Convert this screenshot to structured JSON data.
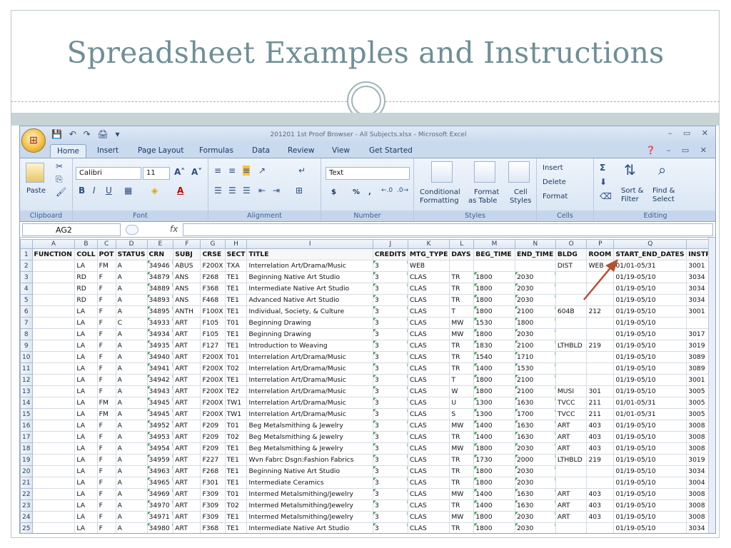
{
  "slide": {
    "title": "Spreadsheet Examples and Instructions"
  },
  "window": {
    "title": "201201 1st Proof Browser - All Subjects.xlsx - Microsoft Excel"
  },
  "tabs": [
    "Home",
    "Insert",
    "Page Layout",
    "Formulas",
    "Data",
    "Review",
    "View",
    "Get Started"
  ],
  "ribbon": {
    "clipboard": {
      "label": "Clipboard",
      "paste": "Paste"
    },
    "font": {
      "label": "Font",
      "name": "Calibri",
      "size": "11"
    },
    "alignment": {
      "label": "Alignment"
    },
    "number": {
      "label": "Number",
      "format": "Text",
      "currency": "$",
      "percent": "%",
      "comma": ","
    },
    "styles": {
      "label": "Styles",
      "conditional": "Conditional",
      "conditional2": "Formatting",
      "format_table": "Format",
      "format_table2": "as Table",
      "cell_styles": "Cell",
      "cell_styles2": "Styles"
    },
    "cells": {
      "label": "Cells",
      "insert": "Insert",
      "delete": "Delete",
      "format": "Format"
    },
    "editing": {
      "label": "Editing",
      "sort": "Sort &",
      "sort2": "Filter",
      "find": "Find &",
      "find2": "Select"
    }
  },
  "namebox": "AG2",
  "formula_symbol": "fx",
  "columns": [
    "A",
    "B",
    "C",
    "D",
    "E",
    "F",
    "G",
    "H",
    "I",
    "J",
    "K",
    "L",
    "M",
    "N",
    "O",
    "P",
    "Q",
    ""
  ],
  "headers": [
    "FUNCTION",
    "COLL",
    "POT",
    "STATUS",
    "CRN",
    "SUBJ",
    "CRSE",
    "SECT",
    "TITLE",
    "CREDITS",
    "MTG_TYPE",
    "DAYS",
    "BEG_TIME",
    "END_TIME",
    "BLDG",
    "ROOM",
    "START_END_DATES",
    "INSTR"
  ],
  "rows": [
    [
      "2",
      "",
      "LA",
      "FM",
      "A",
      "34946",
      "ABUS",
      "F200X",
      "TXA",
      "Interrelation Art/Drama/Music",
      "3",
      "WEB",
      "",
      "",
      "",
      "DIST",
      "WEB",
      "01/01-05/31",
      "3001"
    ],
    [
      "3",
      "",
      "RD",
      "F",
      "A",
      "34879",
      "ANS",
      "F268",
      "TE1",
      "Beginning Native Art Studio",
      "3",
      "CLAS",
      "TR",
      "1800",
      "2030",
      "",
      "",
      "01/19-05/10",
      "3034"
    ],
    [
      "4",
      "",
      "RD",
      "F",
      "A",
      "34889",
      "ANS",
      "F368",
      "TE1",
      "Intermediate Native Art Studio",
      "3",
      "CLAS",
      "TR",
      "1800",
      "2030",
      "",
      "",
      "01/19-05/10",
      "3034"
    ],
    [
      "5",
      "",
      "RD",
      "F",
      "A",
      "34893",
      "ANS",
      "F468",
      "TE1",
      "Advanced Native Art Studio",
      "3",
      "CLAS",
      "TR",
      "1800",
      "2030",
      "",
      "",
      "01/19-05/10",
      "3034"
    ],
    [
      "6",
      "",
      "LA",
      "F",
      "A",
      "34895",
      "ANTH",
      "F100X",
      "TE1",
      "Individual, Society, & Culture",
      "3",
      "CLAS",
      "T",
      "1800",
      "2100",
      "604B",
      "212",
      "01/19-05/10",
      "3001"
    ],
    [
      "7",
      "",
      "LA",
      "F",
      "C",
      "34933",
      "ART",
      "F105",
      "T01",
      "Beginning Drawing",
      "3",
      "CLAS",
      "MW",
      "1530",
      "1800",
      "",
      "",
      "01/19-05/10",
      ""
    ],
    [
      "8",
      "",
      "LA",
      "F",
      "A",
      "34934",
      "ART",
      "F105",
      "TE1",
      "Beginning Drawing",
      "3",
      "CLAS",
      "MW",
      "1800",
      "2030",
      "",
      "",
      "01/19-05/10",
      "3017"
    ],
    [
      "9",
      "",
      "LA",
      "F",
      "A",
      "34935",
      "ART",
      "F127",
      "TE1",
      "Introduction to Weaving",
      "3",
      "CLAS",
      "TR",
      "1830",
      "2100",
      "LTHBLD",
      "219",
      "01/19-05/10",
      "3019"
    ],
    [
      "10",
      "",
      "LA",
      "F",
      "A",
      "34940",
      "ART",
      "F200X",
      "T01",
      "Interrelation Art/Drama/Music",
      "3",
      "CLAS",
      "TR",
      "1540",
      "1710",
      "",
      "",
      "01/19-05/10",
      "3089"
    ],
    [
      "11",
      "",
      "LA",
      "F",
      "A",
      "34941",
      "ART",
      "F200X",
      "T02",
      "Interrelation Art/Drama/Music",
      "3",
      "CLAS",
      "TR",
      "1400",
      "1530",
      "",
      "",
      "01/19-05/10",
      "3089"
    ],
    [
      "12",
      "",
      "LA",
      "F",
      "A",
      "34942",
      "ART",
      "F200X",
      "TE1",
      "Interrelation Art/Drama/Music",
      "3",
      "CLAS",
      "T",
      "1800",
      "2100",
      "",
      "",
      "01/19-05/10",
      "3001"
    ],
    [
      "13",
      "",
      "LA",
      "F",
      "A",
      "34943",
      "ART",
      "F200X",
      "TE2",
      "Interrelation Art/Drama/Music",
      "3",
      "CLAS",
      "W",
      "1800",
      "2100",
      "MUSI",
      "301",
      "01/19-05/10",
      "3005"
    ],
    [
      "14",
      "",
      "LA",
      "FM",
      "A",
      "34945",
      "ART",
      "F200X",
      "TW1",
      "Interrelation Art/Drama/Music",
      "3",
      "CLAS",
      "U",
      "1300",
      "1630",
      "TVCC",
      "211",
      "01/01-05/31",
      "3005"
    ],
    [
      "15",
      "",
      "LA",
      "FM",
      "A",
      "34945",
      "ART",
      "F200X",
      "TW1",
      "Interrelation Art/Drama/Music",
      "3",
      "CLAS",
      "S",
      "1300",
      "1700",
      "TVCC",
      "211",
      "01/01-05/31",
      "3005"
    ],
    [
      "16",
      "",
      "LA",
      "F",
      "A",
      "34952",
      "ART",
      "F209",
      "T01",
      "Beg Metalsmithing & Jewelry",
      "3",
      "CLAS",
      "MW",
      "1400",
      "1630",
      "ART",
      "403",
      "01/19-05/10",
      "3008"
    ],
    [
      "17",
      "",
      "LA",
      "F",
      "A",
      "34953",
      "ART",
      "F209",
      "T02",
      "Beg Metalsmithing & Jewelry",
      "3",
      "CLAS",
      "TR",
      "1400",
      "1630",
      "ART",
      "403",
      "01/19-05/10",
      "3008"
    ],
    [
      "18",
      "",
      "LA",
      "F",
      "A",
      "34954",
      "ART",
      "F209",
      "TE1",
      "Beg Metalsmithing & Jewelry",
      "3",
      "CLAS",
      "MW",
      "1800",
      "2030",
      "ART",
      "403",
      "01/19-05/10",
      "3008"
    ],
    [
      "19",
      "",
      "LA",
      "F",
      "A",
      "34959",
      "ART",
      "F227",
      "TE1",
      "Wvn Fabrc Dsgn:Fashion Fabrics",
      "3",
      "CLAS",
      "TR",
      "1730",
      "2000",
      "LTHBLD",
      "219",
      "01/19-05/10",
      "3019"
    ],
    [
      "20",
      "",
      "LA",
      "F",
      "A",
      "34963",
      "ART",
      "F268",
      "TE1",
      "Beginning Native Art Studio",
      "3",
      "CLAS",
      "TR",
      "1800",
      "2030",
      "",
      "",
      "01/19-05/10",
      "3034"
    ],
    [
      "21",
      "",
      "LA",
      "F",
      "A",
      "34965",
      "ART",
      "F301",
      "TE1",
      "Intermediate Ceramics",
      "3",
      "CLAS",
      "TR",
      "1800",
      "2030",
      "",
      "",
      "01/19-05/10",
      "3004"
    ],
    [
      "22",
      "",
      "LA",
      "F",
      "A",
      "34969",
      "ART",
      "F309",
      "T01",
      "Intermed Metalsmithing/Jewelry",
      "3",
      "CLAS",
      "MW",
      "1400",
      "1630",
      "ART",
      "403",
      "01/19-05/10",
      "3008"
    ],
    [
      "23",
      "",
      "LA",
      "F",
      "A",
      "34970",
      "ART",
      "F309",
      "T02",
      "Intermed Metalsmithing/Jewelry",
      "3",
      "CLAS",
      "TR",
      "1400",
      "1630",
      "ART",
      "403",
      "01/19-05/10",
      "3008"
    ],
    [
      "24",
      "",
      "LA",
      "F",
      "A",
      "34971",
      "ART",
      "F309",
      "TE1",
      "Intermed Metalsmithing/Jewelry",
      "3",
      "CLAS",
      "MW",
      "1800",
      "2030",
      "ART",
      "403",
      "01/19-05/10",
      "3008"
    ],
    [
      "25",
      "",
      "LA",
      "F",
      "A",
      "34980",
      "ART",
      "F368",
      "TE1",
      "Intermediate Native Art Studio",
      "3",
      "CLAS",
      "TR",
      "1800",
      "2030",
      "",
      "",
      "01/19-05/10",
      "3034"
    ]
  ],
  "colors": {
    "accent": "#6e8f95",
    "annotation_arrow": "#b5522e"
  }
}
